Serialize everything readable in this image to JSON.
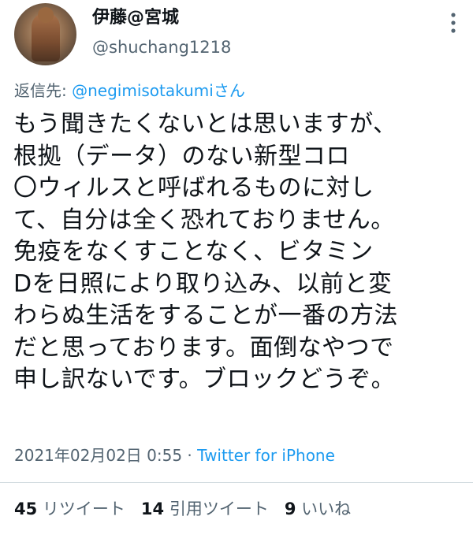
{
  "tweet": {
    "author": {
      "display_name": "伊藤@宮城",
      "handle": "@shuchang1218"
    },
    "reply_to": {
      "prefix": "返信先: ",
      "mention": "@negimisotakumi",
      "suffix": "さん"
    },
    "text": "もう聞きたくないとは思いますが、\n根拠（データ）のない新型コロ\n〇ウィルスと呼ばれるものに対し\nて、自分は全く恐れておりません。\n免疫をなくすことなく、ビタミン\nDを日照により取り込み、以前と変\nわらぬ生活をすることが一番の方法\nだと思っております。面倒なやつで\n申し訳ないです。ブロックどうぞ。",
    "timestamp": "2021年02月02日 0:55",
    "separator": " · ",
    "source": "Twitter for iPhone",
    "stats": {
      "retweets_count": "45",
      "retweets_label": "リツイート",
      "quotes_count": "14",
      "quotes_label": "引用ツイート",
      "likes_count": "9",
      "likes_label": "いいね"
    }
  },
  "icons": {
    "more": "more-vertical-icon"
  },
  "colors": {
    "link": "#1d9bf0",
    "secondary_text": "#536471",
    "primary_text": "#0f1419",
    "divider": "#cfd9de"
  }
}
